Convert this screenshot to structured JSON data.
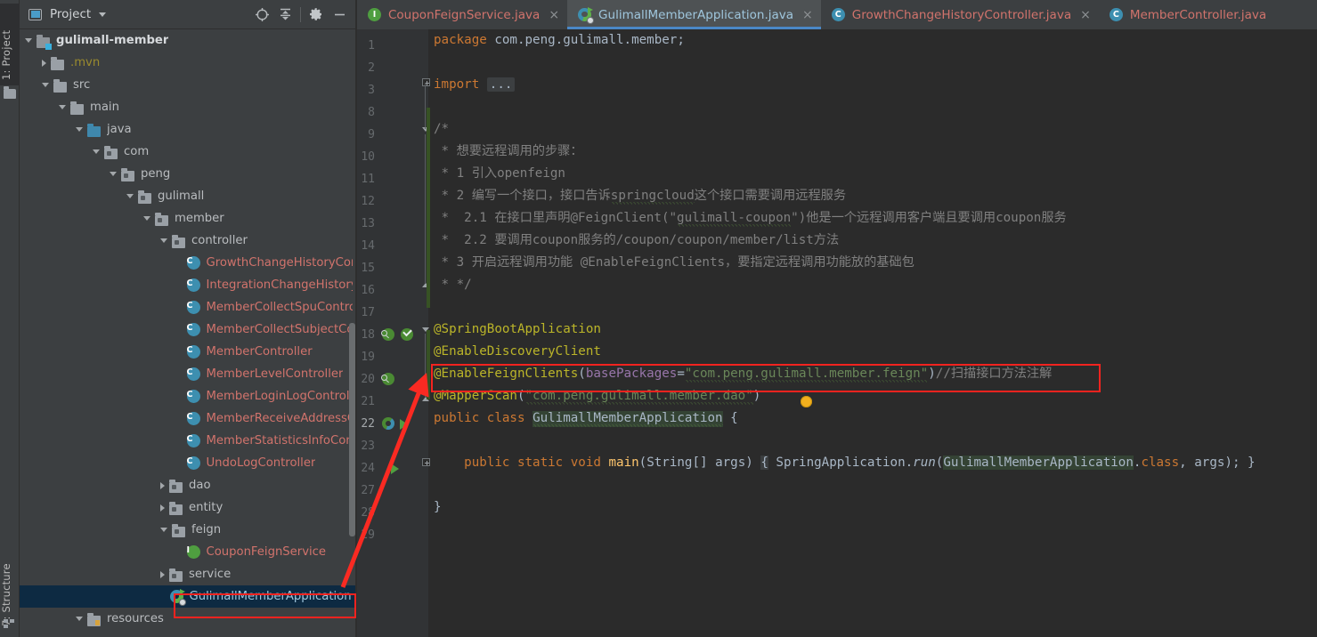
{
  "window": {
    "tool_strip": {
      "top_tab": "1: Project",
      "bottom_tab": "7: Structure"
    }
  },
  "project_panel": {
    "title": "Project",
    "dropdown_icon": "chevron-down-icon",
    "toolbar": [
      {
        "name": "locate-icon",
        "label": "Select Opened File"
      },
      {
        "name": "collapse-all-icon",
        "label": "Collapse All"
      },
      {
        "name": "gear-icon",
        "label": "Settings"
      },
      {
        "name": "hide-icon",
        "label": "Hide"
      }
    ],
    "tree": [
      {
        "label": "gulimall-member",
        "depth": 0,
        "twisty": "open",
        "icon": "module-icon",
        "style": "root"
      },
      {
        "label": ".mvn",
        "depth": 1,
        "twisty": "closed",
        "icon": "folder-icon",
        "style": "excluded"
      },
      {
        "label": "src",
        "depth": 1,
        "twisty": "open",
        "icon": "folder-icon",
        "style": "normal"
      },
      {
        "label": "main",
        "depth": 2,
        "twisty": "open",
        "icon": "folder-icon",
        "style": "normal"
      },
      {
        "label": "java",
        "depth": 3,
        "twisty": "open",
        "icon": "source-folder-icon",
        "style": "normal"
      },
      {
        "label": "com",
        "depth": 4,
        "twisty": "open",
        "icon": "package-icon",
        "style": "normal"
      },
      {
        "label": "peng",
        "depth": 5,
        "twisty": "open",
        "icon": "package-icon",
        "style": "normal"
      },
      {
        "label": "gulimall",
        "depth": 6,
        "twisty": "open",
        "icon": "package-icon",
        "style": "normal"
      },
      {
        "label": "member",
        "depth": 7,
        "twisty": "open",
        "icon": "package-icon",
        "style": "normal"
      },
      {
        "label": "controller",
        "depth": 8,
        "twisty": "open",
        "icon": "package-icon",
        "style": "normal"
      },
      {
        "label": "GrowthChangeHistoryController",
        "depth": 9,
        "twisty": "none",
        "icon": "java-class-icon",
        "style": "error"
      },
      {
        "label": "IntegrationChangeHistoryController",
        "depth": 9,
        "twisty": "none",
        "icon": "java-class-icon",
        "style": "error"
      },
      {
        "label": "MemberCollectSpuController",
        "depth": 9,
        "twisty": "none",
        "icon": "java-class-icon",
        "style": "error"
      },
      {
        "label": "MemberCollectSubjectController",
        "depth": 9,
        "twisty": "none",
        "icon": "java-class-icon",
        "style": "error"
      },
      {
        "label": "MemberController",
        "depth": 9,
        "twisty": "none",
        "icon": "java-class-icon",
        "style": "error"
      },
      {
        "label": "MemberLevelController",
        "depth": 9,
        "twisty": "none",
        "icon": "java-class-icon",
        "style": "error"
      },
      {
        "label": "MemberLoginLogController",
        "depth": 9,
        "twisty": "none",
        "icon": "java-class-icon",
        "style": "error"
      },
      {
        "label": "MemberReceiveAddressController",
        "depth": 9,
        "twisty": "none",
        "icon": "java-class-icon",
        "style": "error"
      },
      {
        "label": "MemberStatisticsInfoController",
        "depth": 9,
        "twisty": "none",
        "icon": "java-class-icon",
        "style": "error"
      },
      {
        "label": "UndoLogController",
        "depth": 9,
        "twisty": "none",
        "icon": "java-class-icon",
        "style": "error"
      },
      {
        "label": "dao",
        "depth": 8,
        "twisty": "closed",
        "icon": "package-icon",
        "style": "normal"
      },
      {
        "label": "entity",
        "depth": 8,
        "twisty": "closed",
        "icon": "package-icon",
        "style": "normal"
      },
      {
        "label": "feign",
        "depth": 8,
        "twisty": "open",
        "icon": "package-icon",
        "style": "normal"
      },
      {
        "label": "CouponFeignService",
        "depth": 9,
        "twisty": "none",
        "icon": "java-interface-icon",
        "style": "error"
      },
      {
        "label": "service",
        "depth": 8,
        "twisty": "closed",
        "icon": "package-icon",
        "style": "normal"
      },
      {
        "label": "GulimallMemberApplication",
        "depth": 8,
        "twisty": "none",
        "icon": "spring-boot-class-icon",
        "style": "selected",
        "selected": true
      },
      {
        "label": "resources",
        "depth": 3,
        "twisty": "open",
        "icon": "resources-folder-icon",
        "style": "normal"
      }
    ],
    "selected_item": "GulimallMemberApplication"
  },
  "editor_tabs": [
    {
      "label": "CouponFeignService.java",
      "icon": "java-interface-icon",
      "active": false,
      "has_error": true,
      "close": "×"
    },
    {
      "label": "GulimallMemberApplication.java",
      "icon": "spring-boot-class-icon",
      "active": true,
      "has_error": false,
      "close": "×"
    },
    {
      "label": "GrowthChangeHistoryController.java",
      "icon": "java-class-icon",
      "active": false,
      "has_error": true,
      "close": "×"
    },
    {
      "label": "MemberController.java",
      "icon": "java-class-icon",
      "active": false,
      "has_error": true,
      "close": ""
    }
  ],
  "editor": {
    "filename": "GulimallMemberApplication.java",
    "current_line": 22,
    "line_numbers": [
      1,
      2,
      3,
      8,
      9,
      10,
      11,
      12,
      13,
      14,
      15,
      16,
      17,
      18,
      19,
      20,
      21,
      22,
      23,
      24,
      27,
      28,
      29
    ],
    "folded_import_placeholder": "...",
    "lines": [
      {
        "n": 1,
        "text": "package com.peng.gulimall.member;"
      },
      {
        "n": 2,
        "text": ""
      },
      {
        "n": 3,
        "text": "import ..."
      },
      {
        "n": 8,
        "text": ""
      },
      {
        "n": 9,
        "text": "/*"
      },
      {
        "n": 10,
        "text": " * 想要远程调用的步骤："
      },
      {
        "n": 11,
        "text": " * 1 引入openfeign"
      },
      {
        "n": 12,
        "text": " * 2 编写一个接口，接口告诉springcloud这个接口需要调用远程服务"
      },
      {
        "n": 13,
        "text": " *  2.1 在接口里声明@FeignClient(\"gulimall-coupon\")他是一个远程调用客户端且要调用coupon服务"
      },
      {
        "n": 14,
        "text": " *  2.2 要调用coupon服务的/coupon/coupon/member/list方法"
      },
      {
        "n": 15,
        "text": " * 3 开启远程调用功能 @EnableFeignClients，要指定远程调用功能放的基础包"
      },
      {
        "n": 16,
        "text": " * */"
      },
      {
        "n": 17,
        "text": ""
      },
      {
        "n": 18,
        "text": "@SpringBootApplication"
      },
      {
        "n": 19,
        "text": "@EnableDiscoveryClient"
      },
      {
        "n": 20,
        "text": "@EnableFeignClients(basePackages=\"com.peng.gulimall.member.feign\")//扫描接口方法注解"
      },
      {
        "n": 21,
        "text": "@MapperScan(\"com.peng.gulimall.member.dao\")"
      },
      {
        "n": 22,
        "text": "public class GulimallMemberApplication {"
      },
      {
        "n": 23,
        "text": ""
      },
      {
        "n": 24,
        "text": "    public static void main(String[] args) { SpringApplication.run(GulimallMemberApplication.class, args); }"
      },
      {
        "n": 27,
        "text": ""
      },
      {
        "n": 28,
        "text": "}"
      },
      {
        "n": 29,
        "text": ""
      }
    ],
    "gutter_icons": [
      {
        "line": 18,
        "name": "spring-bean-icon"
      },
      {
        "line": 18,
        "name": "spring-bean-check-icon"
      },
      {
        "line": 20,
        "name": "spring-bean-icon"
      },
      {
        "line": 22,
        "name": "spring-boot-run-icon"
      },
      {
        "line": 22,
        "name": "run-arrow-icon"
      },
      {
        "line": 24,
        "name": "run-arrow-icon"
      }
    ],
    "inspection_bulb_line": 21
  },
  "annotations": {
    "rectangle_1": {
      "target": "@EnableFeignClients line",
      "color": "#f4231f"
    },
    "rectangle_2": {
      "target": "GulimallMemberApplication tree item",
      "color": "#f4231f"
    },
    "arrow": {
      "from": "tree item GulimallMemberApplication",
      "to": "@EnableFeignClients line",
      "color": "#fa2a22"
    }
  },
  "colors": {
    "editor_bg": "#2b2b2b",
    "panel_bg": "#3c3f41",
    "gutter_bg": "#313335",
    "selection_bg": "#0d2a42",
    "error_text": "#d1736c",
    "annotation_color": "#bbb529",
    "string_color": "#6a8759",
    "keyword_color": "#cc7832",
    "comment_color": "#808080",
    "accent_blue": "#4a88c7",
    "annotation_red": "#f4231f"
  }
}
